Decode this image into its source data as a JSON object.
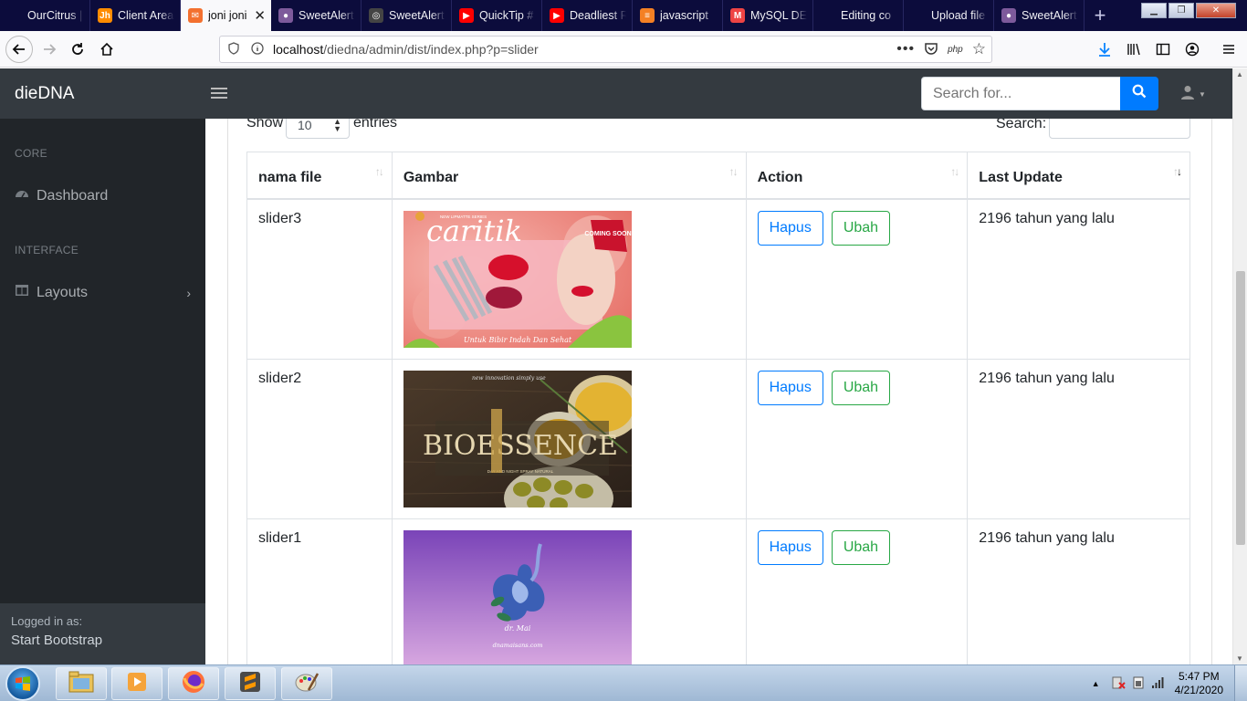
{
  "browser": {
    "tabs": [
      {
        "title": "OurCitrus | Hal",
        "color": "#0c0c3c",
        "glyph": ""
      },
      {
        "title": "Client Area",
        "color": "#ff8c00",
        "glyph": "Jh"
      },
      {
        "title": "joni joni",
        "color": "#f3702f",
        "glyph": "✉",
        "active": true
      },
      {
        "title": "SweetAlert",
        "color": "#7d5a9b",
        "glyph": "●"
      },
      {
        "title": "SweetAlert",
        "color": "#444",
        "glyph": "◎"
      },
      {
        "title": "QuickTip #",
        "color": "#ff0000",
        "glyph": "▶"
      },
      {
        "title": "Deadliest R",
        "color": "#ff0000",
        "glyph": "▶"
      },
      {
        "title": "javascript",
        "color": "#f48024",
        "glyph": "≡"
      },
      {
        "title": "MySQL DE",
        "color": "#e44",
        "glyph": "M"
      },
      {
        "title": "Editing co",
        "color": "#0c0c3c",
        "glyph": ""
      },
      {
        "title": "Upload file",
        "color": "#0c0c3c",
        "glyph": ""
      },
      {
        "title": "SweetAlert",
        "color": "#7d5a9b",
        "glyph": "●"
      }
    ],
    "url_host": "localhost",
    "url_rest": "/diedna/admin/dist/index.php?p=slider"
  },
  "app": {
    "brand": "dieDNA",
    "search_placeholder": "Search for..."
  },
  "sidebar": {
    "core_heading": "CORE",
    "dashboard_label": "Dashboard",
    "interface_heading": "INTERFACE",
    "layouts_label": "Layouts",
    "footer_small": "Logged in as:",
    "footer_name": "Start Bootstrap"
  },
  "datatable": {
    "show_label": "Show",
    "length_value": "10",
    "entries_label": "entries",
    "search_label": "Search:",
    "columns": [
      "nama file",
      "Gambar",
      "Action",
      "Last Update"
    ],
    "rows": [
      {
        "nama_file": "slider3",
        "image": "slider3-caritik-banner",
        "delete_label": "Hapus",
        "edit_label": "Ubah",
        "last_update": "2196 tahun yang lalu"
      },
      {
        "nama_file": "slider2",
        "image": "slider2-bioessence-banner",
        "delete_label": "Hapus",
        "edit_label": "Ubah",
        "last_update": "2196 tahun yang lalu"
      },
      {
        "nama_file": "slider1",
        "image": "slider1-flower-banner",
        "delete_label": "Hapus",
        "edit_label": "Ubah",
        "last_update": "2196 tahun yang lalu"
      }
    ]
  },
  "banners": {
    "slider3_brand": "caritik",
    "slider3_badge": "COMING SOON",
    "slider3_top": "NEW LIPMATTE SERIES",
    "slider3_tagline": "Untuk Bibir Indah Dan Sehat",
    "slider2_brand": "BIOESSENCE",
    "slider2_sub": "DAY AND NIGHT SPRAY NATURAL",
    "slider2_top": "new innovation simply use",
    "slider1_sign": "dr. Mai",
    "slider1_url": "dnamaisans.com"
  },
  "taskbar": {
    "time": "5:47 PM",
    "date": "4/21/2020"
  },
  "colors": {
    "primary": "#007bff",
    "success": "#28a745",
    "dark": "#343a40",
    "sidebar": "#212529"
  }
}
